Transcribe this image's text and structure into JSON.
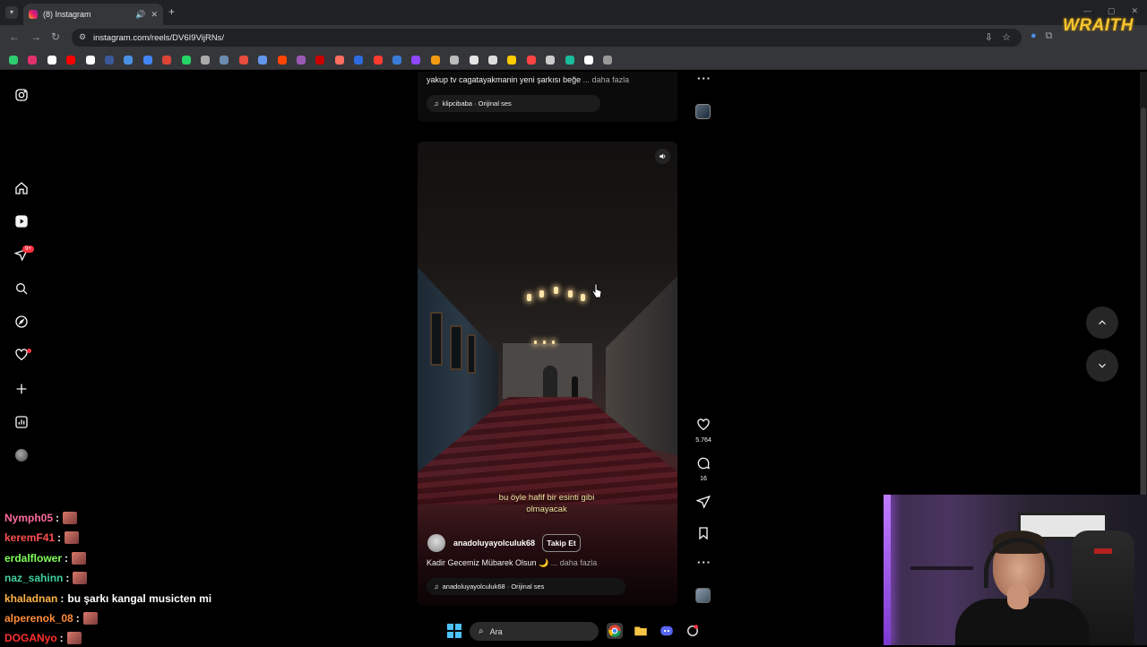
{
  "browser": {
    "tab_title": "(8) Instagram",
    "url": "instagram.com/reels/DV6I9VijRNs/",
    "brand_overlay": "WRAITH"
  },
  "sidebar": {
    "items": [
      {
        "icon": "instagram-logo-icon"
      },
      {
        "icon": "home-icon"
      },
      {
        "icon": "reels-icon"
      },
      {
        "icon": "direct-messages-icon"
      },
      {
        "icon": "search-icon"
      },
      {
        "icon": "explore-icon"
      },
      {
        "icon": "notifications-heart-icon"
      },
      {
        "icon": "create-plus-icon"
      },
      {
        "icon": "dashboard-icon"
      },
      {
        "icon": "profile-avatar"
      }
    ],
    "messages_badge": "9+"
  },
  "previous_reel": {
    "caption": "yakup tv cagatayakmanin yeni şarkısı beğe",
    "more_label": "... daha fazla",
    "audio": "klipcibaba · Orijinal ses"
  },
  "reel": {
    "subtitle_line1": "bu öyle hafif bir esinti gibi",
    "subtitle_line2": "olmayacak",
    "author": "anadoluyayolculuk68",
    "follow_label": "Takip Et",
    "caption": "Kadir Gecemiz Mübarek Olsun 🌙",
    "more_label": "... daha fazla",
    "audio": "anadoluyayolculuk68 · Orijinal ses",
    "likes": "5.764",
    "comments": "16"
  },
  "chat": [
    {
      "user": "Nymph05",
      "color": "#ff6b9d",
      "message": ""
    },
    {
      "user": "keremF41",
      "color": "#ff4f4f",
      "message": ""
    },
    {
      "user": "erdalflower",
      "color": "#7fff5a",
      "message": ""
    },
    {
      "user": "naz_sahinn",
      "color": "#3fd0a0",
      "message": ""
    },
    {
      "user": "khaladnan",
      "color": "#ffb347",
      "message": "bu şarkı kangal musicten mi"
    },
    {
      "user": "alperenok_08",
      "color": "#ff8c3a",
      "message": ""
    },
    {
      "user": "DOGANyo",
      "color": "#ff3030",
      "message": ""
    }
  ],
  "taskbar": {
    "search_placeholder": "Ara"
  }
}
